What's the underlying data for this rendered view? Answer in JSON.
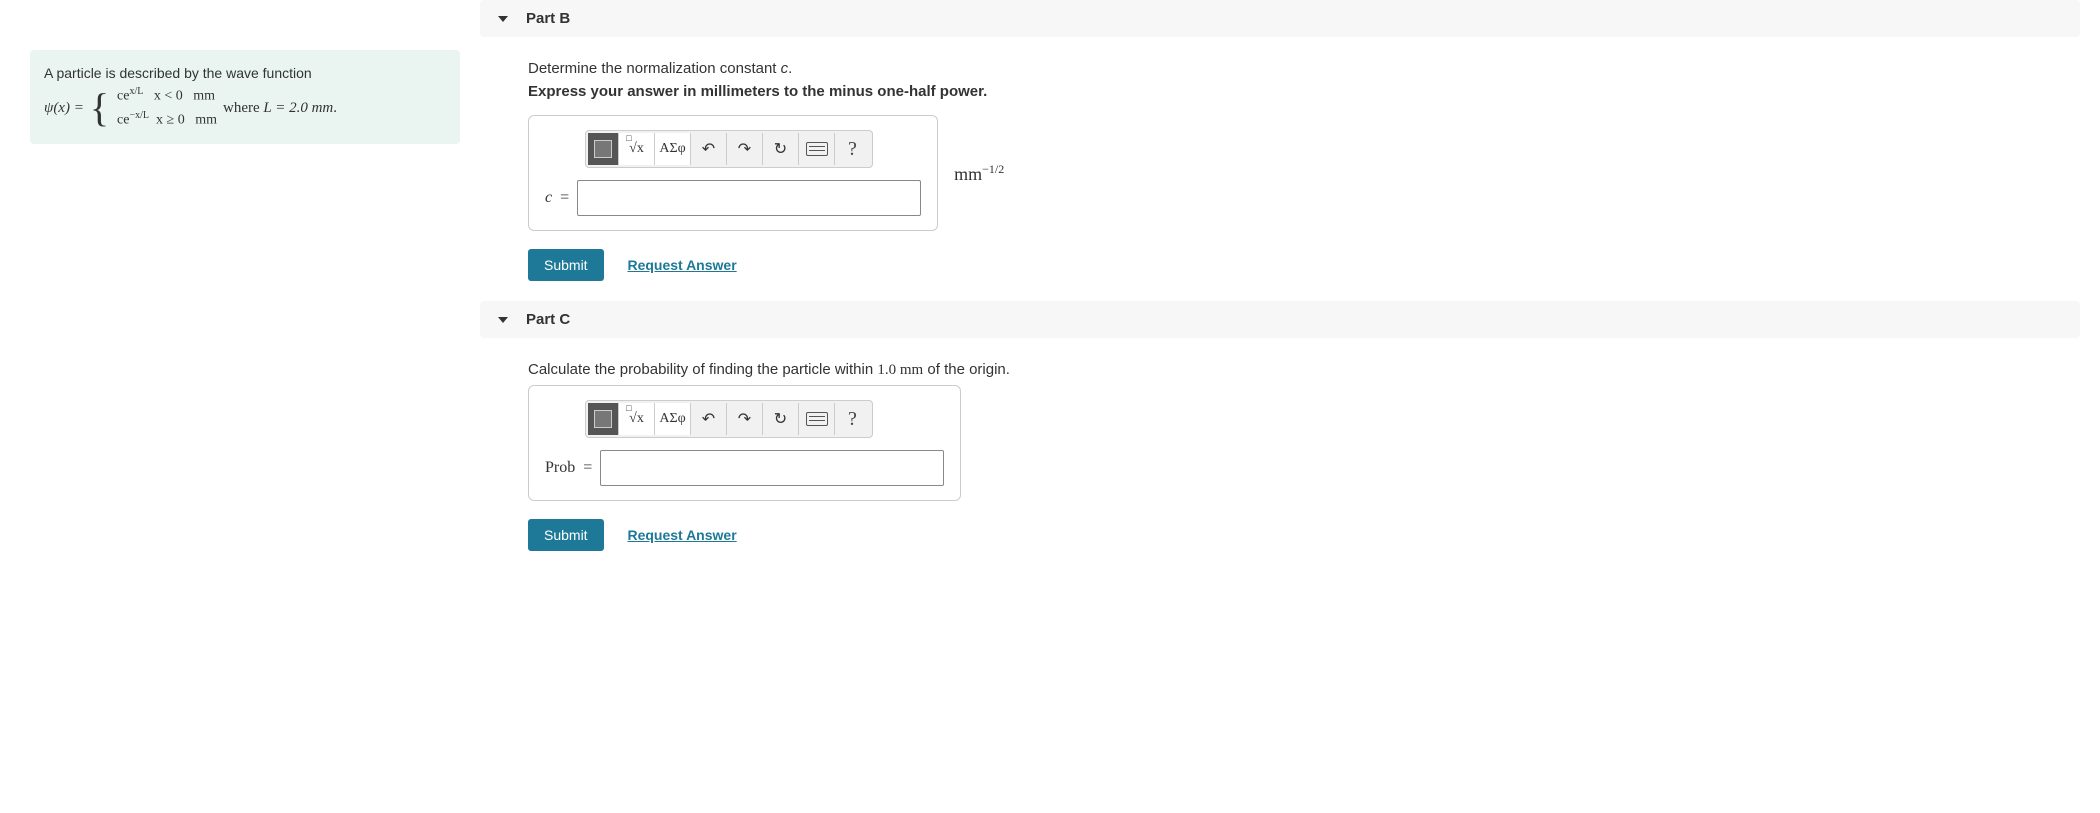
{
  "problem": {
    "intro": "A particle is described by the wave function",
    "psi_label": "ψ(x) = ",
    "branch1": "ce<sup>x/L</sup>&nbsp;&nbsp;&nbsp;x &lt; 0&nbsp;&nbsp;&nbsp;mm",
    "branch2": "ce<sup>−x/L</sup>&nbsp;&nbsp;x ≥ 0&nbsp;&nbsp;&nbsp;mm",
    "where": " where ",
    "l_eq": "L = 2.0 mm",
    "period": "."
  },
  "toolbar": {
    "sqrt": "√x",
    "greek": "ΑΣφ",
    "undo": "↶",
    "redo": "↷",
    "reset": "↻",
    "help": "?"
  },
  "partB": {
    "title": "Part B",
    "prompt_pre": "Determine the normalization constant ",
    "prompt_var": "c",
    "prompt_post": ".",
    "instruct": "Express your answer in millimeters to the minus one-half power.",
    "var": "c",
    "eq": "=",
    "unit": "mm",
    "unit_exp": "−1/2",
    "submit": "Submit",
    "request": "Request Answer"
  },
  "partC": {
    "title": "Part C",
    "prompt_pre": "Calculate the probability of finding the particle within ",
    "prompt_val": "1.0 mm",
    "prompt_post": " of the origin.",
    "var": "Prob",
    "eq": "=",
    "submit": "Submit",
    "request": "Request Answer"
  }
}
